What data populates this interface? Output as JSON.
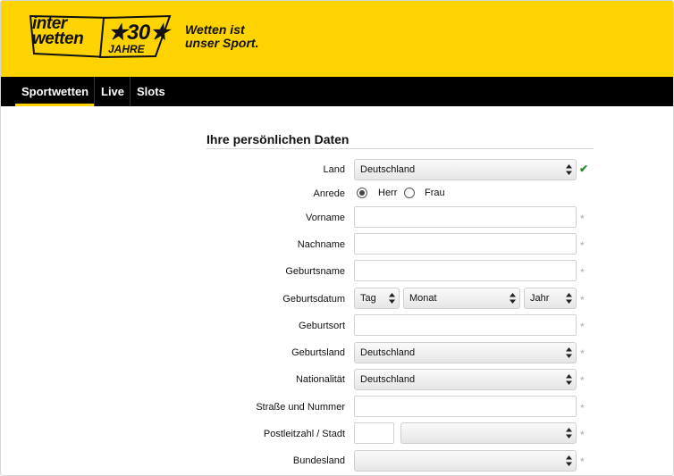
{
  "brand": {
    "logo_line1": "inter",
    "logo_line2": "wetten",
    "anniversary_number": "★30★",
    "anniversary_word": "JAHRE",
    "slogan_line1": "Wetten ist",
    "slogan_line2": "unser Sport.",
    "header_color": "#ffd300"
  },
  "nav": {
    "items": [
      {
        "label": "Sportwetten",
        "active": true
      },
      {
        "label": "Live",
        "active": false
      },
      {
        "label": "Slots",
        "active": false
      }
    ]
  },
  "form": {
    "title": "Ihre persönlichen Daten",
    "required_marker": "*",
    "valid_marker": "✔",
    "fields": {
      "land": {
        "label": "Land",
        "value": "Deutschland"
      },
      "anrede": {
        "label": "Anrede",
        "options": [
          "Herr",
          "Frau"
        ],
        "selected": "Herr"
      },
      "vorname": {
        "label": "Vorname",
        "value": ""
      },
      "nachname": {
        "label": "Nachname",
        "value": ""
      },
      "geburtsname": {
        "label": "Geburtsname",
        "value": ""
      },
      "geburtsdatum": {
        "label": "Geburtsdatum",
        "day": "Tag",
        "month": "Monat",
        "year": "Jahr"
      },
      "geburtsort": {
        "label": "Geburtsort",
        "value": ""
      },
      "geburtsland": {
        "label": "Geburtsland",
        "value": "Deutschland"
      },
      "nationalitaet": {
        "label": "Nationalität",
        "value": "Deutschland"
      },
      "strasse": {
        "label": "Straße und Nummer",
        "value": ""
      },
      "plz_stadt": {
        "label": "Postleitzahl / Stadt",
        "plz": "",
        "stadt": ""
      },
      "bundesland": {
        "label": "Bundesland",
        "value": ""
      }
    }
  }
}
